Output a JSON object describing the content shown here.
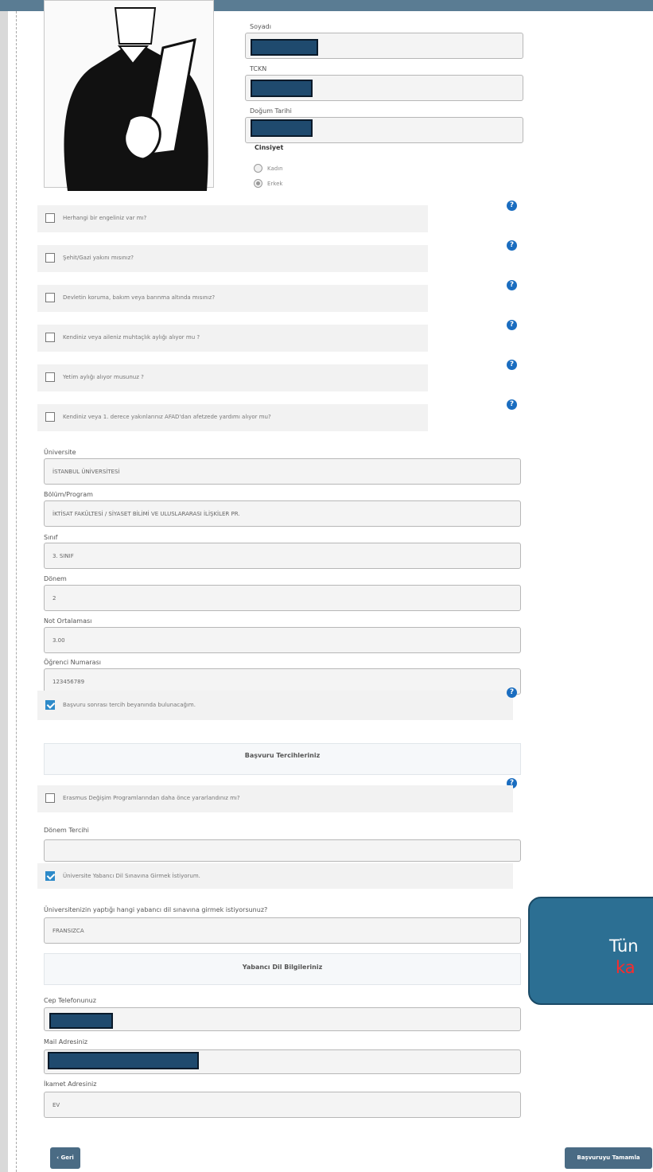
{
  "personal": {
    "surname_label": "Soyadı",
    "tckn_label": "TCKN",
    "dob_label": "Doğum Tarihi",
    "gender_label": "Cinsiyet",
    "gender_options": [
      "Kadın",
      "Erkek"
    ],
    "gender_selected": "Erkek"
  },
  "questions": [
    {
      "text": "Herhangi bir engeliniz var mı?",
      "checked": false
    },
    {
      "text": "Şehit/Gazi yakını mısınız?",
      "checked": false
    },
    {
      "text": "Devletin koruma, bakım veya barınma altında mısınız?",
      "checked": false
    },
    {
      "text": "Kendiniz veya aileniz muhtaçlık aylığı alıyor mu ?",
      "checked": false
    },
    {
      "text": "Yetim aylığı alıyor musunuz ?",
      "checked": false
    },
    {
      "text": "Kendiniz veya 1. derece yakınlarınız AFAD'dan afetzede yardımı alıyor mu?",
      "checked": false
    }
  ],
  "education": {
    "university_label": "Üniversite",
    "university_value": "İSTANBUL ÜNİVERSİTESİ",
    "program_label": "Bölüm/Program",
    "program_value": "İKTİSAT FAKÜLTESİ / SİYASET BİLİMİ VE ULUSLARARASI İLİŞKİLER PR.",
    "class_label": "Sınıf",
    "class_value": "3. SINIF",
    "term_label": "Dönem",
    "term_value": "2",
    "gpa_label": "Not Ortalaması",
    "gpa_value": "3.00",
    "student_no_label": "Öğrenci Numarası",
    "student_no_value": "123456789"
  },
  "declaration": {
    "text": "Başvuru sonrası tercih beyanında bulunacağım.",
    "checked": true
  },
  "preferences": {
    "section_title": "Başvuru Tercihleriniz",
    "erasmus": {
      "text": "Erasmus Değişim Programlarından daha önce yararlandınız mı?",
      "checked": false
    },
    "term_pref_label": "Dönem Tercihi",
    "term_pref_value": "",
    "language_exam": {
      "text": "Üniversite Yabancı Dil Sınavına Girmek İstiyorum.",
      "checked": true
    },
    "language_question": "Üniversitenizin yaptığı hangi yabancı dil sınavına girmek istiyorsunuz?",
    "language_value": "FRANSIZCA"
  },
  "language": {
    "section_title": "Yabancı Dil Bilgileriniz"
  },
  "contact": {
    "phone_label": "Cep Telefonunuz",
    "mail_label": "Mail Adresiniz",
    "address_label": "İkamet Adresiniz",
    "address_value": "EV"
  },
  "buttons": {
    "back": "‹ Geri",
    "complete": "Başvuruyu Tamamla"
  },
  "toast": {
    "line1": "Tün",
    "line2": "ka"
  },
  "colors": {
    "topbar": "#5a7c93",
    "button": "#4a6b84",
    "toast": "#2c6f93",
    "help": "#1a6dc0",
    "redaction": "#1f4a6e"
  }
}
